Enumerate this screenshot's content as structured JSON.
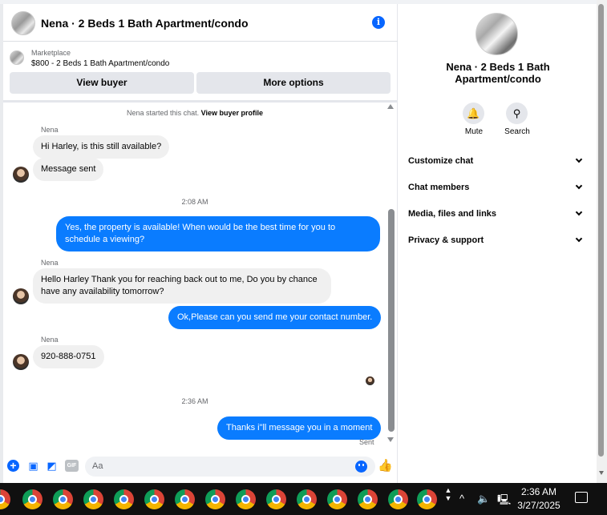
{
  "header": {
    "title": "Nena · 2 Beds 1 Bath Apartment/condo",
    "info_icon": "i"
  },
  "marketplace": {
    "label": "Marketplace",
    "item": "$800 - 2 Beds 1 Bath Apartment/condo",
    "view_buyer_label": "View buyer",
    "more_options_label": "More options"
  },
  "conversation": {
    "system_note_prefix": "Nena started this chat.",
    "system_note_link": "View buyer profile",
    "sender_name": "Nena",
    "msg1": "Hi Harley, is this still available?",
    "msg2": "Message sent",
    "time1": "2:08 AM",
    "msg3_line1": "Yes, the property is available! When would be the best time for you to",
    "msg3_line2": "schedule a viewing?",
    "msg4_line1": "Hello Harley Thank you for reaching back out to me, Do you by chance",
    "msg4_line2": "have any availability tomorrow?",
    "msg5": "Ok,Please can you send me your contact number.",
    "msg6": "920-888-0751",
    "time2": "2:36 AM",
    "msg7": "Thanks i\"ll message you in a moment",
    "status": "Sent"
  },
  "composer": {
    "placeholder": "Aa",
    "gif_label": "GIF"
  },
  "panel": {
    "title": "Nena · 2 Beds 1 Bath Apartment/condo",
    "mute_label": "Mute",
    "search_label": "Search",
    "sections": [
      "Customize chat",
      "Chat members",
      "Media, files and links",
      "Privacy & support"
    ]
  },
  "taskbar": {
    "time": "2:36 AM",
    "date": "3/27/2025"
  },
  "colors": {
    "accent": "#0866ff",
    "outgoing_bubble": "#0a7cff",
    "incoming_bubble": "#f0f0f0"
  }
}
